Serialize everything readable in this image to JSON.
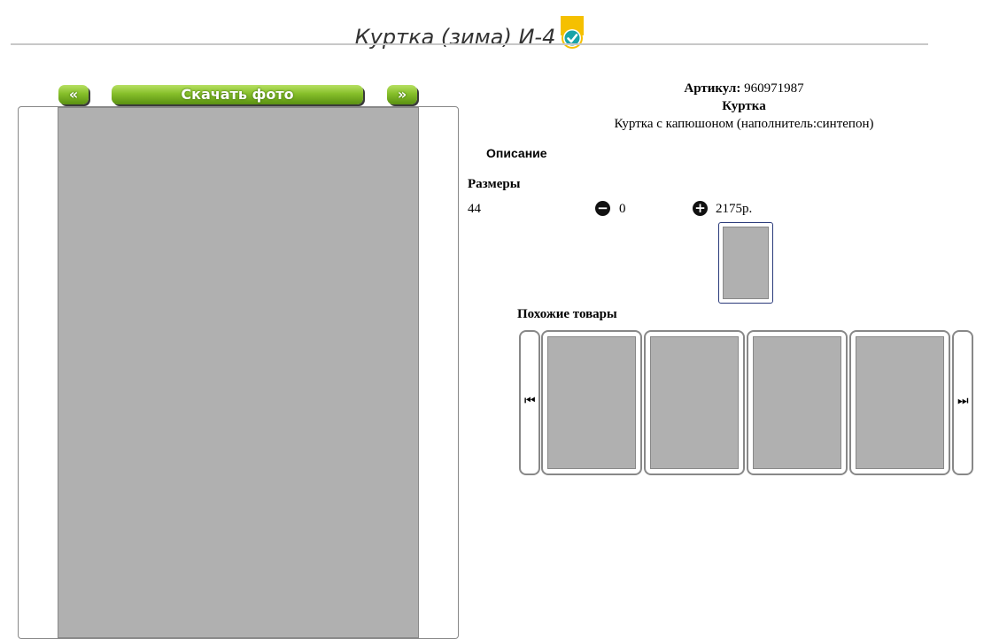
{
  "header": {
    "title": "Куртка (зима) И-4",
    "badge_icon": "verified-check-icon",
    "badge_color": "#f5c000",
    "check_color": "#1aa3a8"
  },
  "nav": {
    "prev_label": "«",
    "download_label": "Скачать фото",
    "next_label": "»"
  },
  "product": {
    "article_label": "Артикул:",
    "article_value": "960971987",
    "name": "Куртка",
    "description": "Куртка с капюшоном (наполнитель:синтепон)",
    "description_heading": "Описание",
    "sizes_heading": "Размеры",
    "size": "44",
    "quantity": "0",
    "price": "2175р.",
    "minus_icon": "minus-circle-icon",
    "plus_icon": "plus-circle-icon"
  },
  "similar": {
    "heading": "Похожие товары",
    "prev_icon": "skip-back-icon",
    "next_icon": "skip-forward-icon",
    "items": [
      {
        "color": "#1e2f6e"
      },
      {
        "color": "#15181c"
      },
      {
        "color": "#15181c"
      },
      {
        "color": "#1a1a1a"
      }
    ]
  }
}
